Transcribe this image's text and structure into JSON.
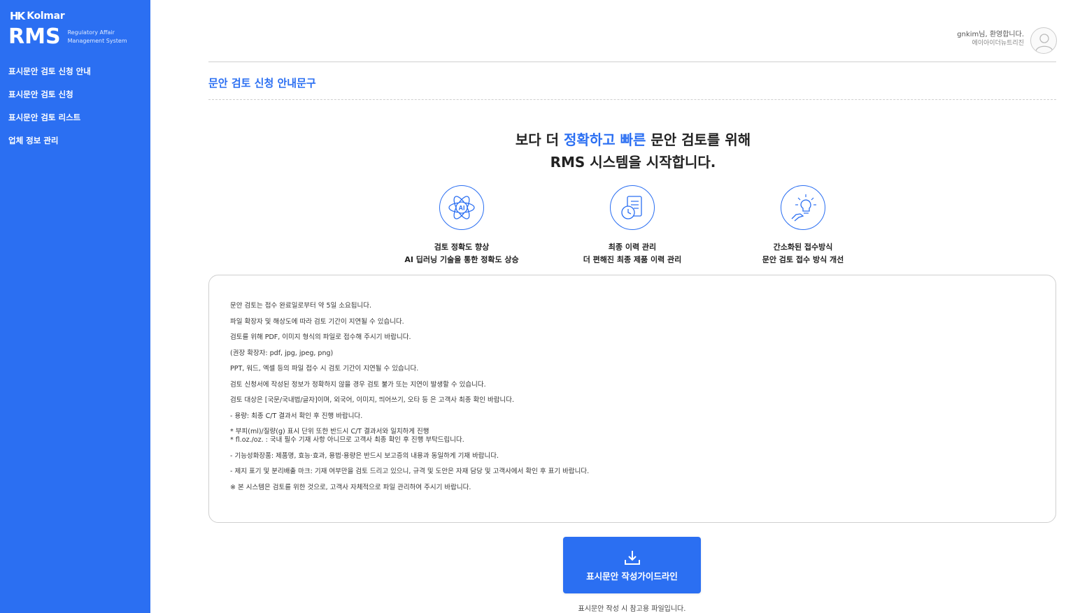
{
  "sidebar": {
    "brand": "Kolmar",
    "brand_mark": "HK",
    "system": "RMS",
    "system_sub_1": "Regulatory Affair",
    "system_sub_2": "Management System",
    "items": [
      {
        "label": "표시문안 검토 신청 안내"
      },
      {
        "label": "표시문안 검토 신청"
      },
      {
        "label": "표시문안 검토 리스트"
      },
      {
        "label": "업체 정보 관리"
      }
    ]
  },
  "header": {
    "greeting": "gnkim님, 환영합니다.",
    "company": "에이아이더뉴트리진"
  },
  "page": {
    "title": "문안 검토 신청 안내문구",
    "hero_1a": "보다 더 ",
    "hero_1b": "정확하고 빠른",
    "hero_1c": " 문안 검토를 위해",
    "hero_2": "RMS 시스템을 시작합니다."
  },
  "features": [
    {
      "icon": "ai-atom-icon",
      "title": "검토 정확도 향상",
      "desc": "AI 딥러닝 기술을 통한 정확도 상승"
    },
    {
      "icon": "document-history-icon",
      "title": "최종 이력 관리",
      "desc": "더 편해진 최종 제품 이력 관리"
    },
    {
      "icon": "lightbulb-hand-icon",
      "title": "간소화된 접수방식",
      "desc": "문안 검토 접수 방식 개선"
    }
  ],
  "notice": [
    "문안 검토는 접수 완료일로부터 약 5일 소요됩니다.",
    "파일 확장자 및 해상도에 따라 검토 기간이 지연될 수 있습니다.",
    "검토를 위해 PDF, 이미지 형식의 파일로 접수해 주시기 바랍니다.",
    "(권장 확장자: pdf, jpg, jpeg, png)",
    "PPT, 워드, 엑셀 등의 파일 접수 시 검토 기간이 지연될 수 있습니다.",
    "검토 신청서에 작성된 정보가 정확하지 않을 경우 검토 불가 또는 지연이 발생할 수 있습니다.",
    "검토 대상은 [국문/국내법/글자]이며, 외국어, 이미지, 띄어쓰기, 오타 등 은 고객사 최종 확인 바랍니다.",
    "- 용량: 최종 C/T 결과서 확인 후 진행 바랍니다.",
    "* 부피(ml)/질량(g) 표시 단위 또한 반드시 C/T 결과서와 일치하게 진행",
    "* fl.oz./oz. : 국내 필수 기재 사항 아니므로 고객사 최종 확인 후 진행 부탁드립니다.",
    "- 기능성화장품: 제품명, 효능·효과, 용법·용량은 반드시 보고증의 내용과 동일하게 기재 바랍니다.",
    "- 제지 표기 및 분리배출 마크: 기재 여부만을 검토 드리고 있으니, 규격 및 도안은 자재 담당 및 고객사에서 확인 후 표기 바랍니다.",
    "※ 본 시스템은 검토를 위한 것으로, 고객사 자체적으로 파일 관리하여 주시기 바랍니다."
  ],
  "guide": {
    "button_label": "표시문안 작성가이드라인",
    "note": "표시문안 작성 시 참고용 파일입니다."
  },
  "colors": {
    "accent": "#2b6ff2",
    "sidebar_bg": "#2b6ff2"
  }
}
